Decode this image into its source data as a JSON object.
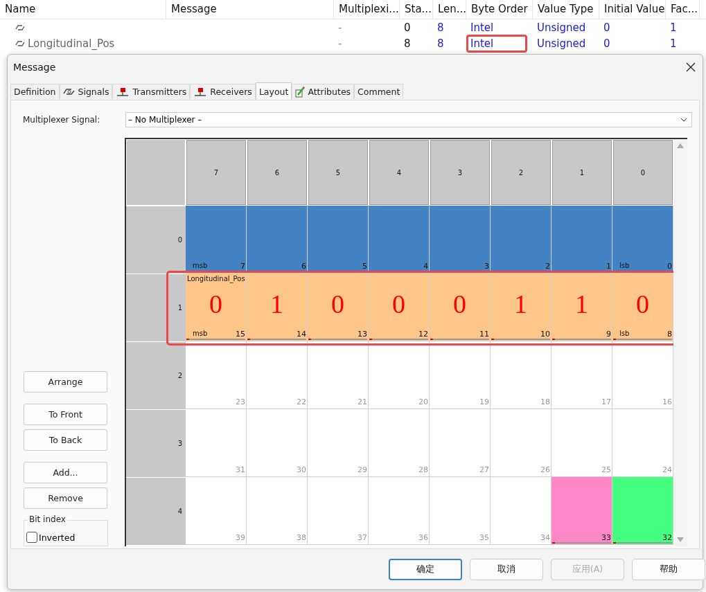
{
  "table": {
    "columns": [
      "Name",
      "Message",
      "Multiplexi...",
      "Sta...",
      "Len...",
      "Byte Order",
      "Value Type",
      "Initial Value",
      "Fac..."
    ],
    "rows": [
      {
        "multiplexing": "-",
        "start": "0",
        "length": "8",
        "byte_order": "Intel",
        "value_type": "Unsigned",
        "initial_value": "0",
        "factor": "1",
        "highlighted": false
      },
      {
        "name": "Longitudinal_Pos",
        "multiplexing": "-",
        "start": "8",
        "length": "8",
        "byte_order": "Intel",
        "value_type": "Unsigned",
        "initial_value": "0",
        "factor": "1",
        "highlighted": true
      }
    ]
  },
  "dialog": {
    "title": "Message",
    "tabs": [
      {
        "label": "Definition",
        "kind": "plain",
        "selected": false
      },
      {
        "label": "Signals",
        "kind": "signals",
        "selected": false
      },
      {
        "label": "Transmitters",
        "kind": "nodes",
        "selected": false
      },
      {
        "label": "Receivers",
        "kind": "nodes",
        "selected": false
      },
      {
        "label": "Layout",
        "kind": "plain",
        "selected": true
      },
      {
        "label": "Attributes",
        "kind": "attributes",
        "selected": false
      },
      {
        "label": "Comment",
        "kind": "plain",
        "selected": false
      }
    ],
    "multiplexer": {
      "label": "Multiplexer Signal:",
      "value": "– No Multiplexer –"
    },
    "side_buttons": [
      "Arrange",
      "To Front",
      "To Back",
      "Add...",
      "Remove"
    ],
    "bit_index": {
      "title": "Bit index",
      "label": "Inverted",
      "checked": false
    },
    "layout": {
      "column_headers": [
        "7",
        "6",
        "5",
        "4",
        "3",
        "2",
        "1",
        "0"
      ],
      "rows": [
        {
          "index": "0",
          "highlighted": false,
          "cells": [
            {
              "bit": "7",
              "tag": "msb",
              "color": "#4383c4"
            },
            {
              "bit": "6",
              "color": "#4383c4"
            },
            {
              "bit": "5",
              "color": "#4383c4"
            },
            {
              "bit": "4",
              "color": "#4383c4"
            },
            {
              "bit": "3",
              "color": "#4383c4"
            },
            {
              "bit": "2",
              "color": "#4383c4"
            },
            {
              "bit": "1",
              "color": "#4383c4"
            },
            {
              "bit": "0",
              "tag": "lsb",
              "color": "#4383c4"
            }
          ]
        },
        {
          "index": "1",
          "highlighted": true,
          "cells": [
            {
              "bit": "15",
              "tag": "msb",
              "signal": "Longitudinal_Pos",
              "value": "0",
              "color": "#ffc68a",
              "extent": true
            },
            {
              "bit": "14",
              "value": "1",
              "color": "#ffc68a",
              "extent": true
            },
            {
              "bit": "13",
              "value": "0",
              "color": "#ffc68a",
              "extent": true
            },
            {
              "bit": "12",
              "value": "0",
              "color": "#ffc68a",
              "extent": true
            },
            {
              "bit": "11",
              "value": "0",
              "color": "#ffc68a",
              "extent": true
            },
            {
              "bit": "10",
              "value": "1",
              "color": "#ffc68a",
              "extent": true
            },
            {
              "bit": "9",
              "value": "1",
              "color": "#ffc68a",
              "extent": true
            },
            {
              "bit": "8",
              "tag": "lsb",
              "value": "0",
              "color": "#ffc68a",
              "extent": true
            }
          ]
        },
        {
          "index": "2",
          "highlighted": false,
          "cells": [
            {
              "bit": "23"
            },
            {
              "bit": "22"
            },
            {
              "bit": "21"
            },
            {
              "bit": "20"
            },
            {
              "bit": "19"
            },
            {
              "bit": "18"
            },
            {
              "bit": "17"
            },
            {
              "bit": "16"
            }
          ]
        },
        {
          "index": "3",
          "highlighted": false,
          "cells": [
            {
              "bit": "31"
            },
            {
              "bit": "30"
            },
            {
              "bit": "29"
            },
            {
              "bit": "28"
            },
            {
              "bit": "27"
            },
            {
              "bit": "26"
            },
            {
              "bit": "25"
            },
            {
              "bit": "24"
            }
          ]
        },
        {
          "index": "4",
          "highlighted": false,
          "cells": [
            {
              "bit": "39"
            },
            {
              "bit": "38"
            },
            {
              "bit": "37"
            },
            {
              "bit": "36"
            },
            {
              "bit": "35"
            },
            {
              "bit": "34"
            },
            {
              "bit": "33",
              "color": "#ff88c8",
              "extent": true
            },
            {
              "bit": "32",
              "color": "#44ff80",
              "extent": true
            }
          ]
        }
      ]
    },
    "footer_buttons": [
      {
        "label": "确定",
        "kind": "default",
        "disabled": false
      },
      {
        "label": "取消",
        "kind": "normal",
        "disabled": false
      },
      {
        "label": "应用(A)",
        "kind": "normal",
        "disabled": true
      },
      {
        "label": "帮助",
        "kind": "normal",
        "disabled": false
      }
    ]
  }
}
